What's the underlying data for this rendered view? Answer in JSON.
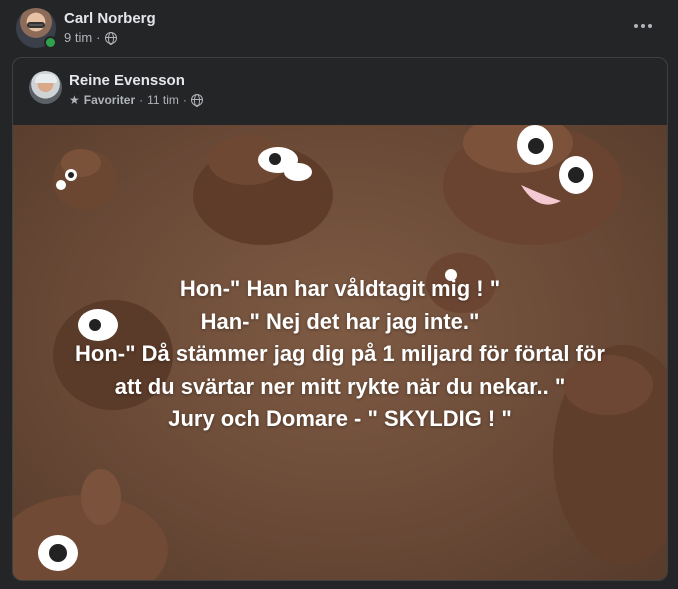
{
  "post": {
    "author": "Carl Norberg",
    "time": "9 tim",
    "separator": "·",
    "privacy_icon": "globe-icon",
    "more_icon": "more-options-icon"
  },
  "shared": {
    "author": "Reine Evensson",
    "favorites": "Favoriter",
    "time": "11 tim",
    "separator": "·",
    "star_icon": "star-icon",
    "privacy_icon": "globe-icon",
    "image_text": [
      "Hon-\" Han har våldtagit mig ! \"",
      "Han-\" Nej det har jag inte.\"",
      "Hon-\" Då stämmer jag dig på 1 miljard för förtal för",
      "att du svärtar ner mitt rykte när du nekar.. \"",
      "Jury och Domare - \" SKYLDIG ! \""
    ]
  },
  "colors": {
    "background": "#242526",
    "text_primary": "#e4e6eb",
    "text_secondary": "#b0b3b8",
    "online": "#31a24c",
    "image_brown": "#6a4a37"
  }
}
